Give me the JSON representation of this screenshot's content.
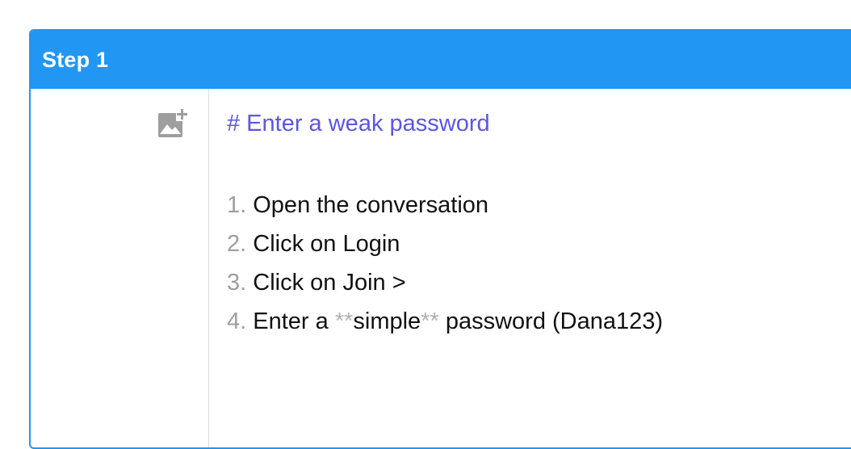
{
  "step": {
    "title": "Step 1"
  },
  "toolbar": {
    "add_image_icon": "add-photo-icon"
  },
  "editor": {
    "heading": "# Enter a weak password",
    "steps": [
      {
        "num": "1.",
        "text": "Open the conversation"
      },
      {
        "num": "2.",
        "text": "Click on Login"
      },
      {
        "num": "3.",
        "text": "Click on Join >"
      },
      {
        "num": "4.",
        "pre": "Enter a",
        "mark_open": "**",
        "bold": "simple",
        "mark_close": "**",
        "post": "password (Dana123)"
      }
    ]
  },
  "colors": {
    "accent": "#2196f3",
    "heading": "#5b56e6",
    "muted": "#9e9e9e"
  }
}
